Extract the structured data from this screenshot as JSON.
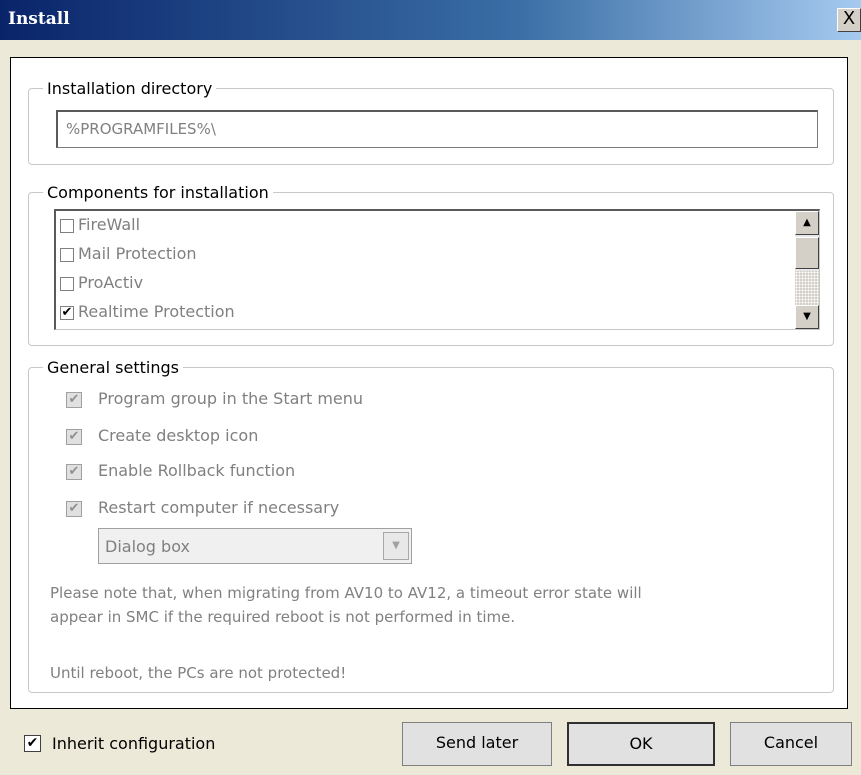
{
  "window": {
    "title": "Install",
    "close_glyph": "X"
  },
  "installation_directory": {
    "legend": "Installation directory",
    "value": "%PROGRAMFILES%\\"
  },
  "components": {
    "legend": "Components for installation",
    "items": [
      {
        "label": "FireWall",
        "checked": false
      },
      {
        "label": "Mail Protection",
        "checked": false
      },
      {
        "label": "ProActiv",
        "checked": false
      },
      {
        "label": "Realtime Protection",
        "checked": true
      }
    ]
  },
  "general_settings": {
    "legend": "General settings",
    "options": [
      {
        "label": "Program group in the Start menu",
        "checked": true
      },
      {
        "label": "Create desktop icon",
        "checked": true
      },
      {
        "label": "Enable Rollback function",
        "checked": true
      },
      {
        "label": "Restart computer if necessary",
        "checked": true
      }
    ],
    "restart_mode": {
      "selected": "Dialog box"
    },
    "note_line1": "Please note that, when migrating from AV10 to AV12, a timeout error state will",
    "note_line2": "appear in SMC if the required reboot is not performed in time.",
    "warning": "Until reboot, the PCs are not protected!"
  },
  "footer": {
    "inherit_label": "Inherit configuration",
    "inherit_checked": true,
    "send_later_label": "Send later",
    "ok_label": "OK",
    "cancel_label": "Cancel"
  },
  "icons": {
    "check": "✔",
    "scroll_up": "▲",
    "scroll_down": "▼",
    "dropdown_arrow": "▼"
  }
}
